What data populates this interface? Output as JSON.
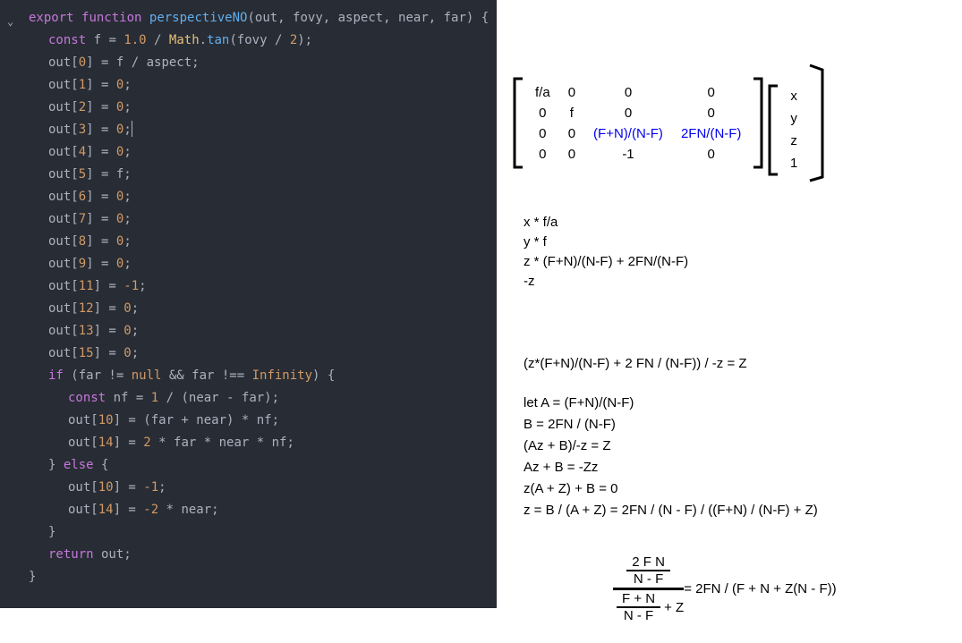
{
  "code": {
    "l1_export": "export",
    "l1_function": "function",
    "l1_fnname": "perspectiveNO",
    "l1_params": "(out, fovy, aspect, near, far) {",
    "l2_const": "const",
    "l2_var": "f",
    "l2_eq": " = ",
    "l2_num1": "1.0",
    "l2_div": " / ",
    "l2_math": "Math",
    "l2_dot": ".",
    "l2_tan": "tan",
    "l2_rest": "(fovy / ",
    "l2_num2": "2",
    "l2_end": ");",
    "l3": "out[",
    "l3_idx": "0",
    "l3_rest": "] = f / aspect;",
    "l4_idx": "1",
    "l4_rest": "] = ",
    "l4_val": "0",
    "l4_end": ";",
    "l5_idx": "2",
    "l6_idx": "3",
    "l7_idx": "4",
    "l8_idx": "5",
    "l8_rest": "] = f;",
    "l9_idx": "6",
    "l10_idx": "7",
    "l11_idx": "8",
    "l12_idx": "9",
    "l13_idx": "11",
    "l13_val": "-1",
    "l14_idx": "12",
    "l15_idx": "13",
    "l16_idx": "15",
    "l17_if": "if",
    "l17_cond1": " (far != ",
    "l17_null": "null",
    "l17_cond2": " && far !== ",
    "l17_inf": "Infinity",
    "l17_end": ") {",
    "l18_const": "const",
    "l18_var": " nf = ",
    "l18_num": "1",
    "l18_rest": " / (near - far);",
    "l19_idx": "10",
    "l19_rest": "] = (far + near) * nf;",
    "l20_idx": "14",
    "l20_rest": "] = ",
    "l20_num": "2",
    "l20_rest2": " * far * near * nf;",
    "l21_else": "} ",
    "l21_else2": "else",
    "l21_rest": " {",
    "l22_idx": "10",
    "l22_rest": "] = ",
    "l22_val": "-1",
    "l22_end": ";",
    "l23_idx": "14",
    "l23_rest": "] = ",
    "l23_val": "-2",
    "l23_rest2": " * near;",
    "l24": "}",
    "l25_return": "return",
    "l25_rest": " out;",
    "l26": "}"
  },
  "matrix": {
    "r1c1": "f/a",
    "r1c2": "0",
    "r1c3": "0",
    "r1c4": "0",
    "r2c1": "0",
    "r2c2": "f",
    "r2c3": "0",
    "r2c4": "0",
    "r3c1": "0",
    "r3c2": "0",
    "r3c3": "(F+N)/(N-F)",
    "r3c4": "2FN/(N-F)",
    "r4c1": "0",
    "r4c2": "0",
    "r4c3": "-1",
    "r4c4": "0"
  },
  "vector": {
    "v1": "x",
    "v2": "y",
    "v3": "z",
    "v4": "1"
  },
  "mult": {
    "m1": "x * f/a",
    "m2": "y * f",
    "m3": "z * (F+N)/(N-F) + 2FN/(N-F)",
    "m4": "-z"
  },
  "deriv": {
    "d1": "(z*(F+N)/(N-F) + 2 FN / (N-F)) / -z = Z",
    "d2": "let A = (F+N)/(N-F)",
    "d3": "B = 2FN / (N-F)",
    "d4": "(Az + B)/-z = Z",
    "d5": "Az + B = -Zz",
    "d6": "z(A + Z) + B = 0",
    "d7": "z = B / (A + Z) = 2FN / (N - F) / ((F+N) / (N-F) + Z)"
  },
  "fraction": {
    "top_num": "2 F N",
    "top_den": "N - F",
    "bot_num": "F + N",
    "bot_den": "N - F",
    "plus_z": " + Z",
    "equals": " = 2FN / (F + N + Z(N - F))"
  }
}
